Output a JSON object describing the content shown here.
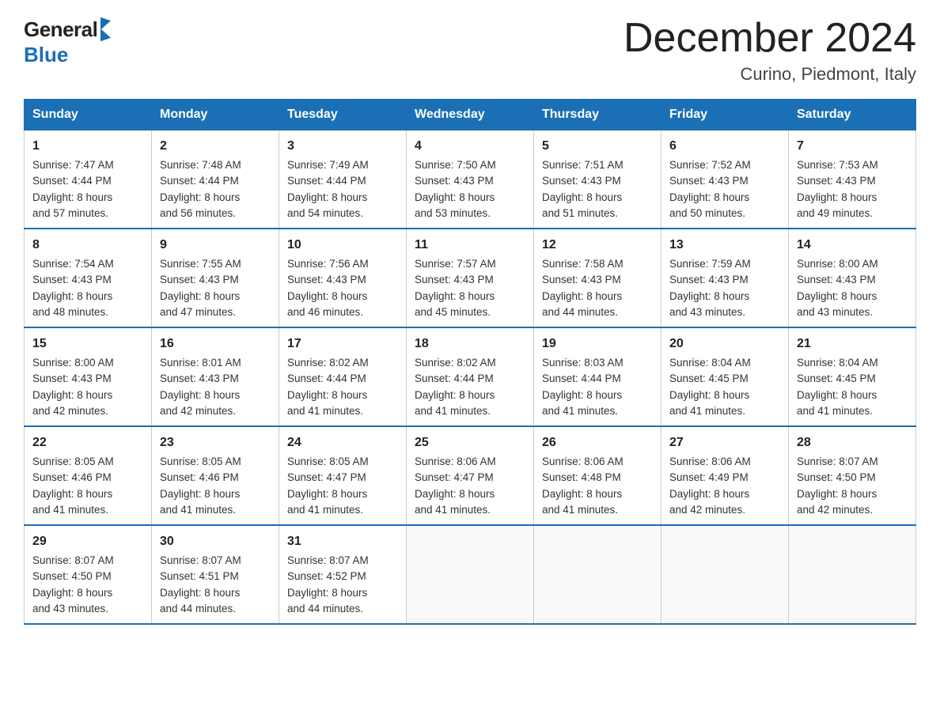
{
  "logo": {
    "general": "General",
    "blue": "Blue"
  },
  "title": "December 2024",
  "location": "Curino, Piedmont, Italy",
  "days_of_week": [
    "Sunday",
    "Monday",
    "Tuesday",
    "Wednesday",
    "Thursday",
    "Friday",
    "Saturday"
  ],
  "weeks": [
    [
      {
        "day": "1",
        "sunrise": "7:47 AM",
        "sunset": "4:44 PM",
        "daylight": "8 hours and 57 minutes."
      },
      {
        "day": "2",
        "sunrise": "7:48 AM",
        "sunset": "4:44 PM",
        "daylight": "8 hours and 56 minutes."
      },
      {
        "day": "3",
        "sunrise": "7:49 AM",
        "sunset": "4:44 PM",
        "daylight": "8 hours and 54 minutes."
      },
      {
        "day": "4",
        "sunrise": "7:50 AM",
        "sunset": "4:43 PM",
        "daylight": "8 hours and 53 minutes."
      },
      {
        "day": "5",
        "sunrise": "7:51 AM",
        "sunset": "4:43 PM",
        "daylight": "8 hours and 51 minutes."
      },
      {
        "day": "6",
        "sunrise": "7:52 AM",
        "sunset": "4:43 PM",
        "daylight": "8 hours and 50 minutes."
      },
      {
        "day": "7",
        "sunrise": "7:53 AM",
        "sunset": "4:43 PM",
        "daylight": "8 hours and 49 minutes."
      }
    ],
    [
      {
        "day": "8",
        "sunrise": "7:54 AM",
        "sunset": "4:43 PM",
        "daylight": "8 hours and 48 minutes."
      },
      {
        "day": "9",
        "sunrise": "7:55 AM",
        "sunset": "4:43 PM",
        "daylight": "8 hours and 47 minutes."
      },
      {
        "day": "10",
        "sunrise": "7:56 AM",
        "sunset": "4:43 PM",
        "daylight": "8 hours and 46 minutes."
      },
      {
        "day": "11",
        "sunrise": "7:57 AM",
        "sunset": "4:43 PM",
        "daylight": "8 hours and 45 minutes."
      },
      {
        "day": "12",
        "sunrise": "7:58 AM",
        "sunset": "4:43 PM",
        "daylight": "8 hours and 44 minutes."
      },
      {
        "day": "13",
        "sunrise": "7:59 AM",
        "sunset": "4:43 PM",
        "daylight": "8 hours and 43 minutes."
      },
      {
        "day": "14",
        "sunrise": "8:00 AM",
        "sunset": "4:43 PM",
        "daylight": "8 hours and 43 minutes."
      }
    ],
    [
      {
        "day": "15",
        "sunrise": "8:00 AM",
        "sunset": "4:43 PM",
        "daylight": "8 hours and 42 minutes."
      },
      {
        "day": "16",
        "sunrise": "8:01 AM",
        "sunset": "4:43 PM",
        "daylight": "8 hours and 42 minutes."
      },
      {
        "day": "17",
        "sunrise": "8:02 AM",
        "sunset": "4:44 PM",
        "daylight": "8 hours and 41 minutes."
      },
      {
        "day": "18",
        "sunrise": "8:02 AM",
        "sunset": "4:44 PM",
        "daylight": "8 hours and 41 minutes."
      },
      {
        "day": "19",
        "sunrise": "8:03 AM",
        "sunset": "4:44 PM",
        "daylight": "8 hours and 41 minutes."
      },
      {
        "day": "20",
        "sunrise": "8:04 AM",
        "sunset": "4:45 PM",
        "daylight": "8 hours and 41 minutes."
      },
      {
        "day": "21",
        "sunrise": "8:04 AM",
        "sunset": "4:45 PM",
        "daylight": "8 hours and 41 minutes."
      }
    ],
    [
      {
        "day": "22",
        "sunrise": "8:05 AM",
        "sunset": "4:46 PM",
        "daylight": "8 hours and 41 minutes."
      },
      {
        "day": "23",
        "sunrise": "8:05 AM",
        "sunset": "4:46 PM",
        "daylight": "8 hours and 41 minutes."
      },
      {
        "day": "24",
        "sunrise": "8:05 AM",
        "sunset": "4:47 PM",
        "daylight": "8 hours and 41 minutes."
      },
      {
        "day": "25",
        "sunrise": "8:06 AM",
        "sunset": "4:47 PM",
        "daylight": "8 hours and 41 minutes."
      },
      {
        "day": "26",
        "sunrise": "8:06 AM",
        "sunset": "4:48 PM",
        "daylight": "8 hours and 41 minutes."
      },
      {
        "day": "27",
        "sunrise": "8:06 AM",
        "sunset": "4:49 PM",
        "daylight": "8 hours and 42 minutes."
      },
      {
        "day": "28",
        "sunrise": "8:07 AM",
        "sunset": "4:50 PM",
        "daylight": "8 hours and 42 minutes."
      }
    ],
    [
      {
        "day": "29",
        "sunrise": "8:07 AM",
        "sunset": "4:50 PM",
        "daylight": "8 hours and 43 minutes."
      },
      {
        "day": "30",
        "sunrise": "8:07 AM",
        "sunset": "4:51 PM",
        "daylight": "8 hours and 44 minutes."
      },
      {
        "day": "31",
        "sunrise": "8:07 AM",
        "sunset": "4:52 PM",
        "daylight": "8 hours and 44 minutes."
      },
      null,
      null,
      null,
      null
    ]
  ],
  "labels": {
    "sunrise": "Sunrise:",
    "sunset": "Sunset:",
    "daylight": "Daylight:"
  }
}
